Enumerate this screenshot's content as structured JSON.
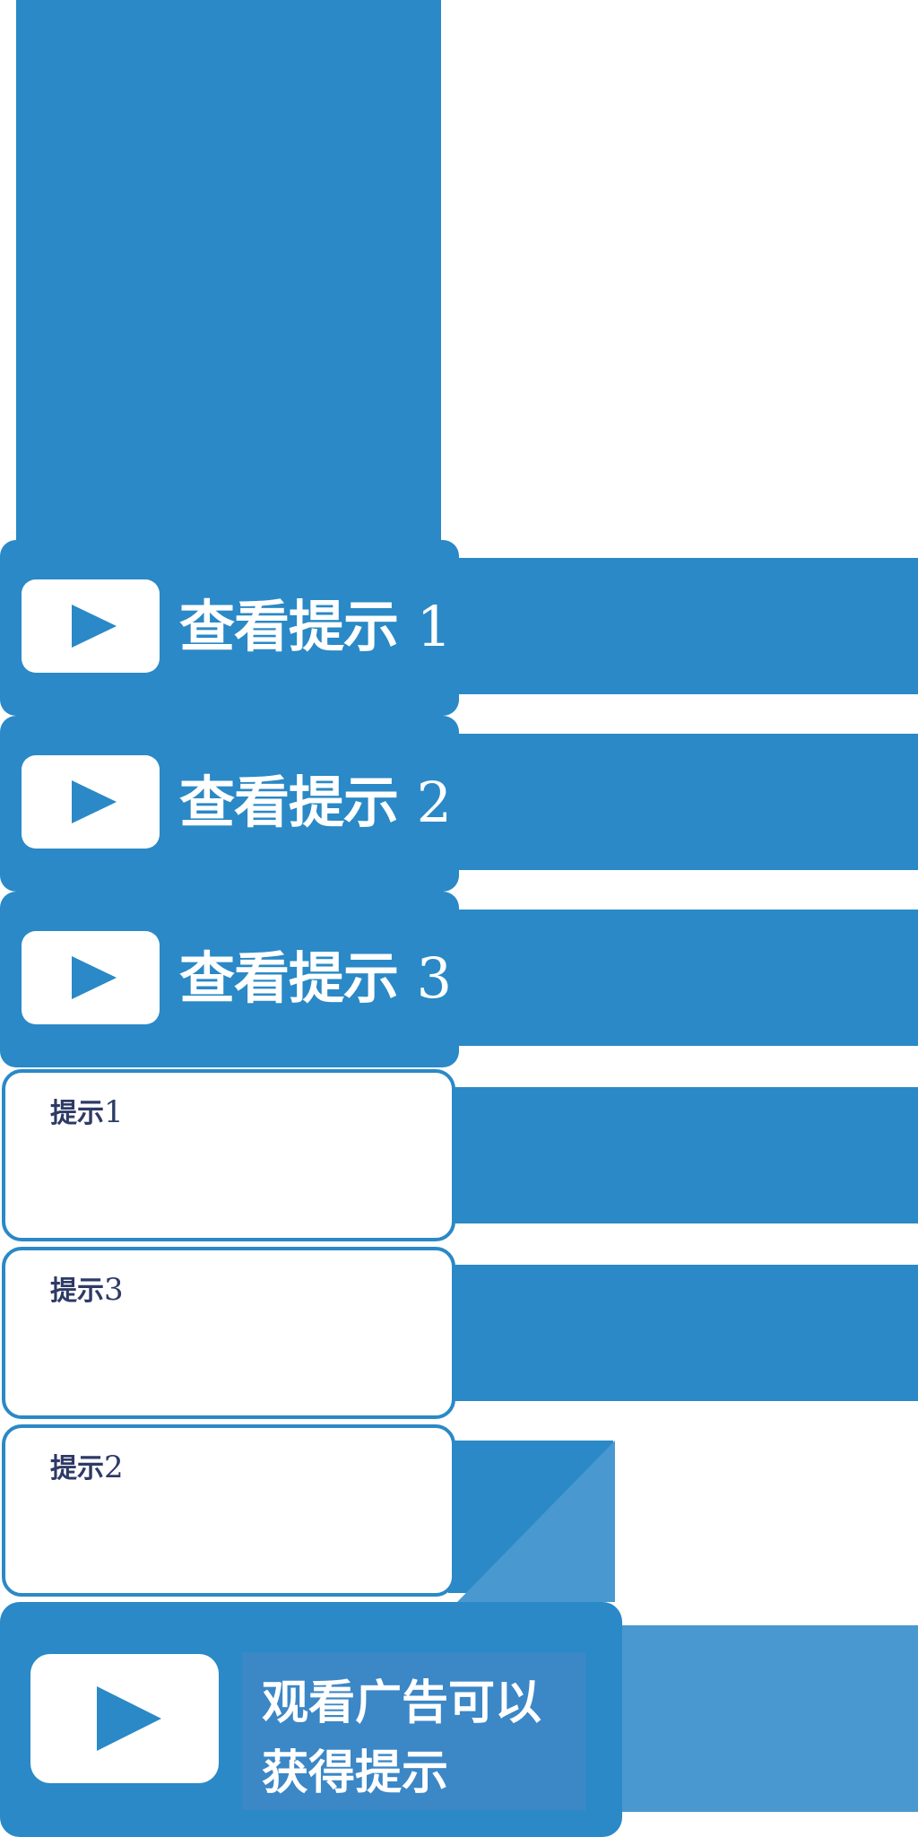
{
  "colors": {
    "primary_blue": "#2a89c6",
    "light_blue": "#4a98d0",
    "hint_title": "#2e3a66",
    "white": "#ffffff"
  },
  "hint_buttons": [
    {
      "label": "查看提示",
      "number": "1",
      "icon": "play-icon"
    },
    {
      "label": "查看提示",
      "number": "2",
      "icon": "play-icon"
    },
    {
      "label": "查看提示",
      "number": "3",
      "icon": "play-icon"
    }
  ],
  "hint_panels": [
    {
      "title": "提示",
      "number": "1"
    },
    {
      "title": "提示",
      "number": "3"
    },
    {
      "title": "提示",
      "number": "2"
    }
  ],
  "ad_button": {
    "line1": "观看广告可以",
    "line2": "获得提示",
    "icon": "play-icon"
  }
}
